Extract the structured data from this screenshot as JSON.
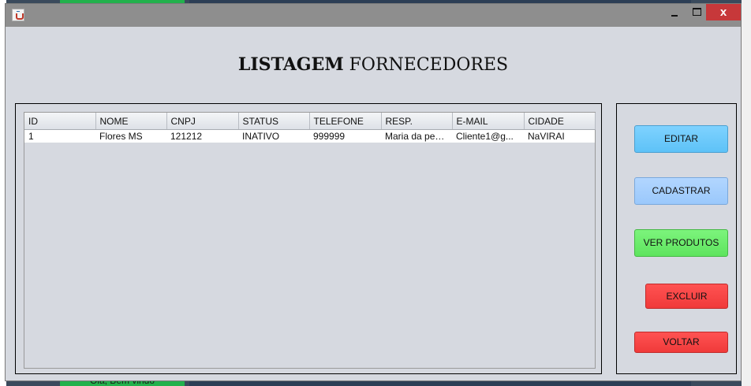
{
  "window": {
    "close_symbol": "x"
  },
  "heading": {
    "bold": "LISTAGEM",
    "regular": " FORNECEDORES"
  },
  "table": {
    "columns": [
      "ID",
      "NOME",
      "CNPJ",
      "STATUS",
      "TELEFONE",
      "RESP.",
      "E-MAIL",
      "CIDADE"
    ],
    "rows": [
      [
        "1",
        "Flores MS",
        "121212",
        "INATIVO",
        "999999",
        "Maria da pen...",
        "Cliente1@g...",
        "NaVIRAI"
      ]
    ]
  },
  "buttons": {
    "editar": "EDITAR",
    "cadastrar": "CADASTRAR",
    "ver_produtos": "VER PRODUTOS",
    "excluir": "EXCLUIR",
    "voltar": "VOLTAR"
  },
  "background": {
    "bottom_text": "Olá, Bem vindo"
  },
  "colors": {
    "editar": "#6ecbff",
    "cadastrar": "#a5cffd",
    "ver_produtos": "#6ced6c",
    "excluir": "#f64545",
    "voltar": "#f64545",
    "close": "#c7383a"
  }
}
